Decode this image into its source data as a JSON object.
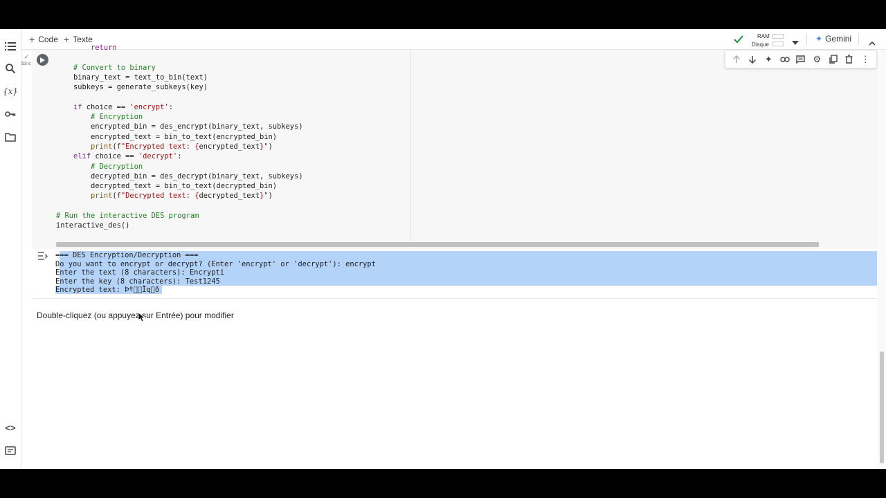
{
  "toolbar": {
    "add_code_label": "Code",
    "add_text_label": "Texte",
    "ram_label": "RAM",
    "disk_label": "Disque",
    "gemini_label": "Gemini"
  },
  "cell": {
    "exec_time": "53 s",
    "code_lines": [
      {
        "indent": "        ",
        "parts": [
          {
            "t": "return",
            "c": "kw"
          }
        ]
      },
      {
        "indent": "",
        "parts": []
      },
      {
        "indent": "    ",
        "parts": [
          {
            "t": "# Convert to binary",
            "c": "cm"
          }
        ]
      },
      {
        "indent": "    ",
        "parts": [
          {
            "t": "binary_text = text_to_bin(text)",
            "c": ""
          }
        ]
      },
      {
        "indent": "    ",
        "parts": [
          {
            "t": "subkeys = generate_subkeys(key)",
            "c": ""
          }
        ]
      },
      {
        "indent": "",
        "parts": []
      },
      {
        "indent": "    ",
        "parts": [
          {
            "t": "if",
            "c": "kw"
          },
          {
            "t": " choice == ",
            "c": ""
          },
          {
            "t": "'encrypt'",
            "c": "str"
          },
          {
            "t": ":",
            "c": ""
          }
        ]
      },
      {
        "indent": "        ",
        "parts": [
          {
            "t": "# Encryption",
            "c": "cm"
          }
        ]
      },
      {
        "indent": "        ",
        "parts": [
          {
            "t": "encrypted_bin = des_encrypt(binary_text, subkeys)",
            "c": ""
          }
        ]
      },
      {
        "indent": "        ",
        "parts": [
          {
            "t": "encrypted_text = bin_to_text(encrypted_bin)",
            "c": ""
          }
        ]
      },
      {
        "indent": "        ",
        "parts": [
          {
            "t": "print",
            "c": "fn"
          },
          {
            "t": "(",
            "c": ""
          },
          {
            "t": "f\"Encrypted text: {",
            "c": "str"
          },
          {
            "t": "encrypted_text",
            "c": ""
          },
          {
            "t": "}\"",
            "c": "str"
          },
          {
            "t": ")",
            "c": ""
          }
        ]
      },
      {
        "indent": "    ",
        "parts": [
          {
            "t": "elif",
            "c": "kw"
          },
          {
            "t": " choice == ",
            "c": ""
          },
          {
            "t": "'decrypt'",
            "c": "str"
          },
          {
            "t": ":",
            "c": ""
          }
        ]
      },
      {
        "indent": "        ",
        "parts": [
          {
            "t": "# Decryption",
            "c": "cm"
          }
        ]
      },
      {
        "indent": "        ",
        "parts": [
          {
            "t": "decrypted_bin = des_decrypt(binary_text, subkeys)",
            "c": ""
          }
        ]
      },
      {
        "indent": "        ",
        "parts": [
          {
            "t": "decrypted_text = bin_to_text(decrypted_bin)",
            "c": ""
          }
        ]
      },
      {
        "indent": "        ",
        "parts": [
          {
            "t": "print",
            "c": "fn"
          },
          {
            "t": "(",
            "c": ""
          },
          {
            "t": "f\"Decrypted text: {",
            "c": "str"
          },
          {
            "t": "decrypted_text",
            "c": ""
          },
          {
            "t": "}\"",
            "c": "str"
          },
          {
            "t": ")",
            "c": ""
          }
        ]
      },
      {
        "indent": "",
        "parts": []
      },
      {
        "indent": "",
        "parts": [
          {
            "t": "# Run the interactive DES program",
            "c": "cm"
          }
        ]
      },
      {
        "indent": "",
        "parts": [
          {
            "t": "interactive_des()",
            "c": ""
          }
        ]
      }
    ]
  },
  "output": {
    "lines": [
      "=== DES Encryption/Decryption ===",
      "Do you want to encrypt or decrypt? (Enter 'encrypt' or 'decrypt'): encrypt",
      "Enter the text (8 characters): Encrypti",
      "Enter the key (8 characters): Test1245",
      "Encrypted text: Þº\u0000\u0000Ìq\u0000ð"
    ]
  },
  "text_cell": {
    "prompt": "Double-cliquez (ou appuyez sur Entrée) pour modifier"
  },
  "colors": {
    "selection": "#b4d3f8",
    "check": "#1e8e3e",
    "gemini_star": "#4285f4"
  }
}
